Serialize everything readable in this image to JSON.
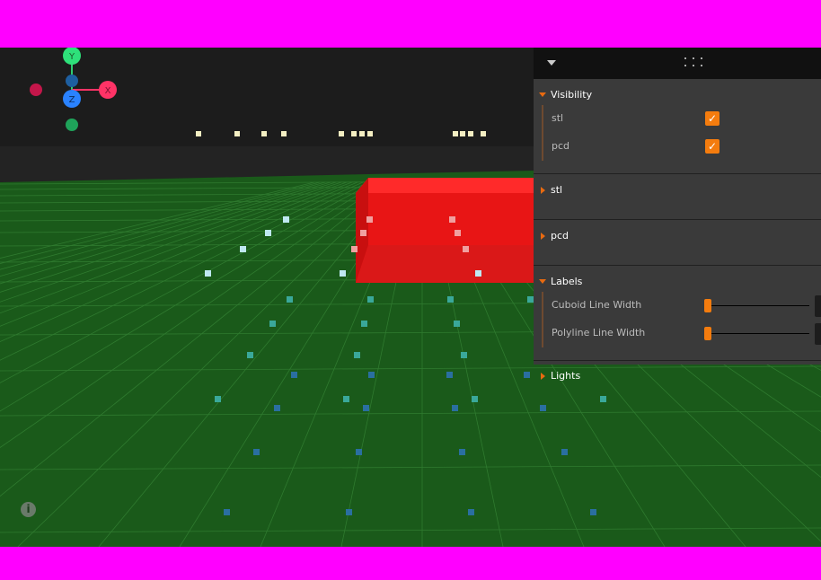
{
  "gizmo": {
    "x_label": "X",
    "y_label": "Y",
    "z_label": "Z"
  },
  "colors": {
    "accent": "#f47c0e",
    "ground": "#1a5a1a",
    "sky": "#1c1c1c",
    "cuboid": "#e81515",
    "panel": "#3a3a3a",
    "panel_header": "#111111"
  },
  "panel": {
    "collapse_icon": "caret-down-icon",
    "drag_icon": "drag-handle-icon",
    "folders": [
      {
        "title": "Visibility",
        "open": true,
        "rows": [
          {
            "label": "stl",
            "checked": true
          },
          {
            "label": "pcd",
            "checked": true
          }
        ]
      },
      {
        "title": "stl",
        "open": false
      },
      {
        "title": "pcd",
        "open": false
      },
      {
        "title": "Labels",
        "open": true,
        "rows": [
          {
            "label": "Cuboid Line Width",
            "value_fraction": 0.0
          },
          {
            "label": "Polyline Line Width",
            "value_fraction": 0.0
          }
        ]
      },
      {
        "title": "Lights",
        "open": false
      }
    ]
  },
  "info_icon": "info-icon",
  "info_glyph": "i"
}
